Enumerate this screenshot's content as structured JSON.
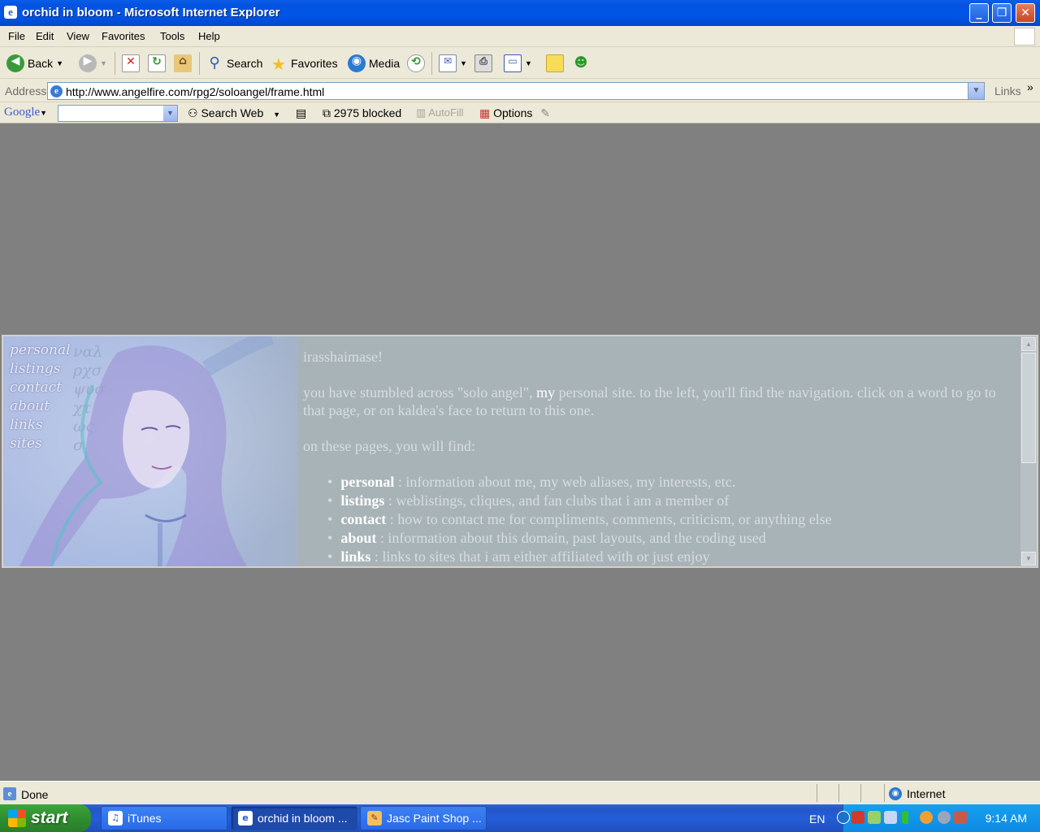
{
  "window": {
    "title": "orchid in bloom - Microsoft Internet Explorer",
    "controls": [
      "minimize",
      "maximize",
      "close"
    ]
  },
  "menu": [
    "File",
    "Edit",
    "View",
    "Favorites",
    "Tools",
    "Help"
  ],
  "toolbar": {
    "back": "Back",
    "search": "Search",
    "favorites": "Favorites",
    "media": "Media"
  },
  "address": {
    "label": "Address",
    "url": "http://www.angelfire.com/rpg2/soloangel/frame.html",
    "links": "Links"
  },
  "google_bar": {
    "logo": "Google",
    "search_web": "Search Web",
    "blocked": "2975 blocked",
    "autofill": "AutoFill",
    "options": "Options"
  },
  "page": {
    "nav": [
      "personal",
      "listings",
      "contact",
      "about",
      "links",
      "sites"
    ],
    "greeting": "irasshaimase!",
    "intro_before": "you have stumbled across \"solo angel\", ",
    "intro_highlight": "my",
    "intro_after": " personal site. to the left, you'll find the navigation. click on a word to go to that page, or on kaldea's face to return to this one.",
    "find_heading": "on these pages, you will find:",
    "items": [
      {
        "term": "personal",
        "desc": " : information about me, my web aliases, my interests, etc."
      },
      {
        "term": "listings",
        "desc": " : weblistings, cliques, and fan clubs that i am a member of"
      },
      {
        "term": "contact",
        "desc": " : how to contact me for compliments, comments, criticism, or anything else"
      },
      {
        "term": "about",
        "desc": " : information about this domain, past layouts, and the coding used"
      },
      {
        "term": "links",
        "desc": " : links to sites that i am either affiliated with or just enjoy"
      }
    ]
  },
  "status": {
    "text": "Done",
    "zone": "Internet"
  },
  "taskbar": {
    "start": "start",
    "tasks": [
      "iTunes",
      "orchid in bloom ...",
      "Jasc Paint Shop ..."
    ],
    "lang": "EN",
    "clock": "9:14 AM"
  }
}
